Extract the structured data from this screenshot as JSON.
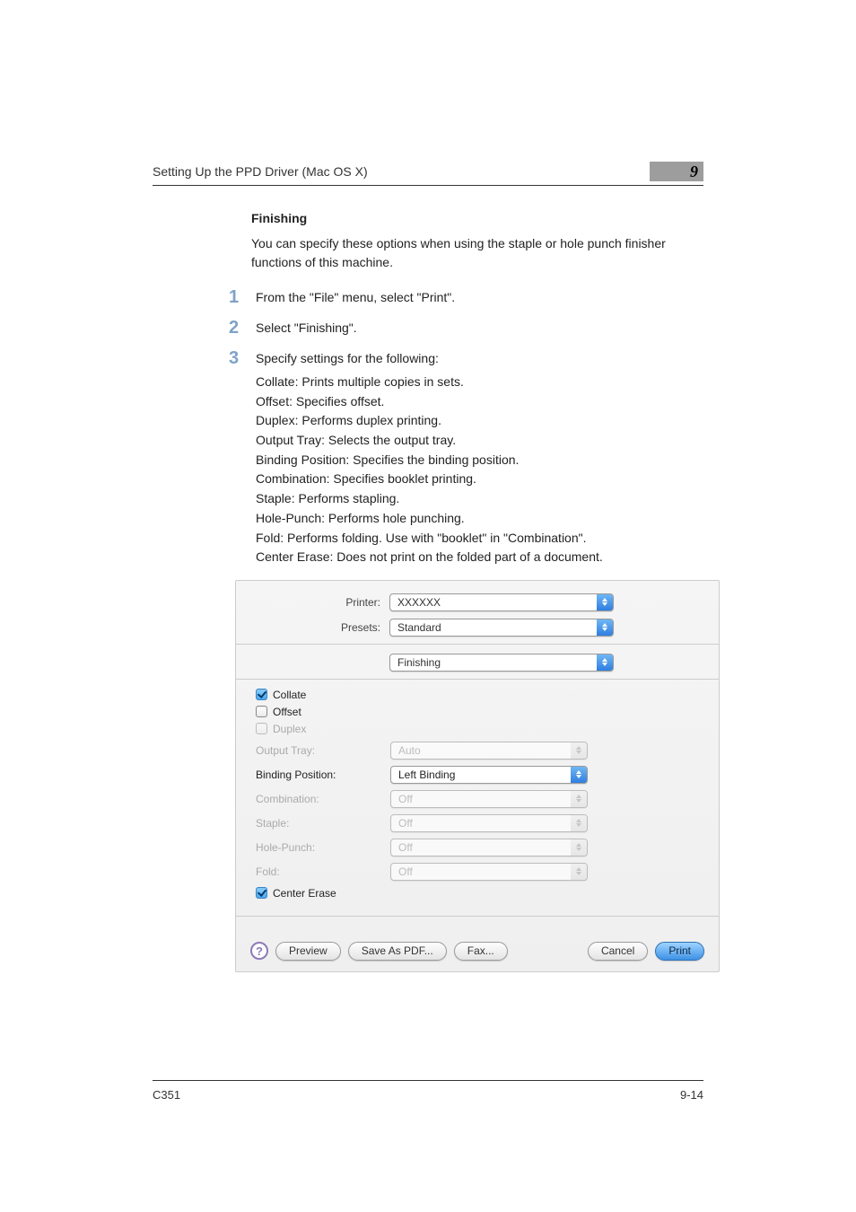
{
  "header": {
    "title": "Setting Up the PPD Driver (Mac OS X)",
    "chapter_number": "9"
  },
  "section": {
    "title": "Finishing",
    "intro": "You can specify these options when using the staple or hole punch finisher functions of this machine."
  },
  "steps": [
    {
      "num": "1",
      "text": "From the \"File\" menu, select \"Print\"."
    },
    {
      "num": "2",
      "text": "Select \"Finishing\"."
    },
    {
      "num": "3",
      "text": "Specify settings for the following:"
    }
  ],
  "sublist": [
    "Collate: Prints multiple copies in sets.",
    "Offset: Specifies offset.",
    "Duplex: Performs duplex printing.",
    "Output Tray: Selects the output tray.",
    "Binding Position: Specifies the binding position.",
    "Combination: Specifies booklet printing.",
    "Staple: Performs stapling.",
    "Hole-Punch: Performs hole punching.",
    "Fold: Performs folding. Use with \"booklet\" in \"Combination\".",
    "Center Erase: Does not print on the folded part of a document."
  ],
  "dialog": {
    "printer_label": "Printer:",
    "printer_value": "XXXXXX",
    "presets_label": "Presets:",
    "presets_value": "Standard",
    "panel_value": "Finishing",
    "checks": {
      "collate": "Collate",
      "offset": "Offset",
      "duplex": "Duplex",
      "center_erase": "Center Erase"
    },
    "rows": {
      "output_tray": {
        "label": "Output Tray:",
        "value": "Auto"
      },
      "binding_position": {
        "label": "Binding Position:",
        "value": "Left Binding"
      },
      "combination": {
        "label": "Combination:",
        "value": "Off"
      },
      "staple": {
        "label": "Staple:",
        "value": "Off"
      },
      "hole_punch": {
        "label": "Hole-Punch:",
        "value": "Off"
      },
      "fold": {
        "label": "Fold:",
        "value": "Off"
      }
    },
    "buttons": {
      "help": "?",
      "preview": "Preview",
      "save_as_pdf": "Save As PDF...",
      "fax": "Fax...",
      "cancel": "Cancel",
      "print": "Print"
    }
  },
  "footer": {
    "left": "C351",
    "right": "9-14"
  }
}
